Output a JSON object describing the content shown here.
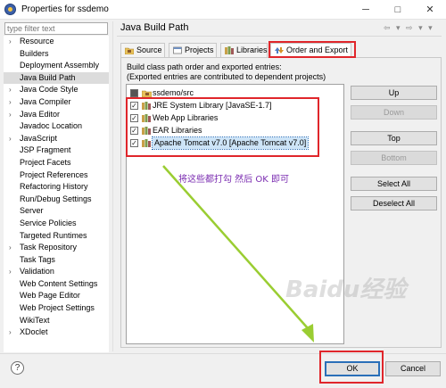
{
  "window": {
    "title": "Properties for ssdemo",
    "minimize": "─",
    "maximize": "□",
    "close": "✕"
  },
  "filter": {
    "placeholder": "type filter text"
  },
  "sidebar": {
    "items": [
      {
        "label": "Resource",
        "expandable": true
      },
      {
        "label": "Builders"
      },
      {
        "label": "Deployment Assembly"
      },
      {
        "label": "Java Build Path",
        "selected": true
      },
      {
        "label": "Java Code Style",
        "expandable": true
      },
      {
        "label": "Java Compiler",
        "expandable": true
      },
      {
        "label": "Java Editor",
        "expandable": true
      },
      {
        "label": "Javadoc Location"
      },
      {
        "label": "JavaScript",
        "expandable": true
      },
      {
        "label": "JSP Fragment"
      },
      {
        "label": "Project Facets"
      },
      {
        "label": "Project References"
      },
      {
        "label": "Refactoring History"
      },
      {
        "label": "Run/Debug Settings"
      },
      {
        "label": "Server"
      },
      {
        "label": "Service Policies"
      },
      {
        "label": "Targeted Runtimes"
      },
      {
        "label": "Task Repository",
        "expandable": true
      },
      {
        "label": "Task Tags"
      },
      {
        "label": "Validation",
        "expandable": true
      },
      {
        "label": "Web Content Settings"
      },
      {
        "label": "Web Page Editor"
      },
      {
        "label": "Web Project Settings"
      },
      {
        "label": "WikiText"
      },
      {
        "label": "XDoclet",
        "expandable": true
      }
    ]
  },
  "main": {
    "title": "Java Build Path",
    "nav": "⇦ ▾ ⇨ ▾ ▾",
    "tabs": [
      {
        "label": "Source",
        "icon": "source-folder-icon"
      },
      {
        "label": "Projects",
        "icon": "projects-icon"
      },
      {
        "label": "Libraries",
        "icon": "libraries-icon"
      },
      {
        "label": "Order and Export",
        "icon": "order-export-icon",
        "active": true
      }
    ],
    "description_line1": "Build class path order and exported entries:",
    "description_line2": "(Exported entries are contributed to dependent projects)",
    "entries": [
      {
        "label": "ssdemo/src",
        "checked": "filled",
        "icon": "source-folder-icon"
      },
      {
        "label": "JRE System Library [JavaSE-1.7]",
        "checked": true,
        "icon": "library-icon"
      },
      {
        "label": "Web App Libraries",
        "checked": true,
        "icon": "library-icon"
      },
      {
        "label": "EAR Libraries",
        "checked": true,
        "icon": "library-icon"
      },
      {
        "label": "Apache Tomcat v7.0 [Apache Tomcat v7.0]",
        "checked": true,
        "icon": "library-icon",
        "selected": true
      }
    ],
    "buttons": {
      "up": "Up",
      "down": "Down",
      "top": "Top",
      "bottom": "Bottom",
      "select_all": "Select All",
      "deselect_all": "Deselect All"
    }
  },
  "footer": {
    "help": "?",
    "ok": "OK",
    "cancel": "Cancel"
  },
  "annotation": {
    "text": "将这些都打勾 然后 OK 即可"
  },
  "watermark": {
    "text": "Baidu经验"
  },
  "colors": {
    "highlight": "#e0262b",
    "annotation": "#7a2bb0",
    "arrow": "#9acd32"
  }
}
